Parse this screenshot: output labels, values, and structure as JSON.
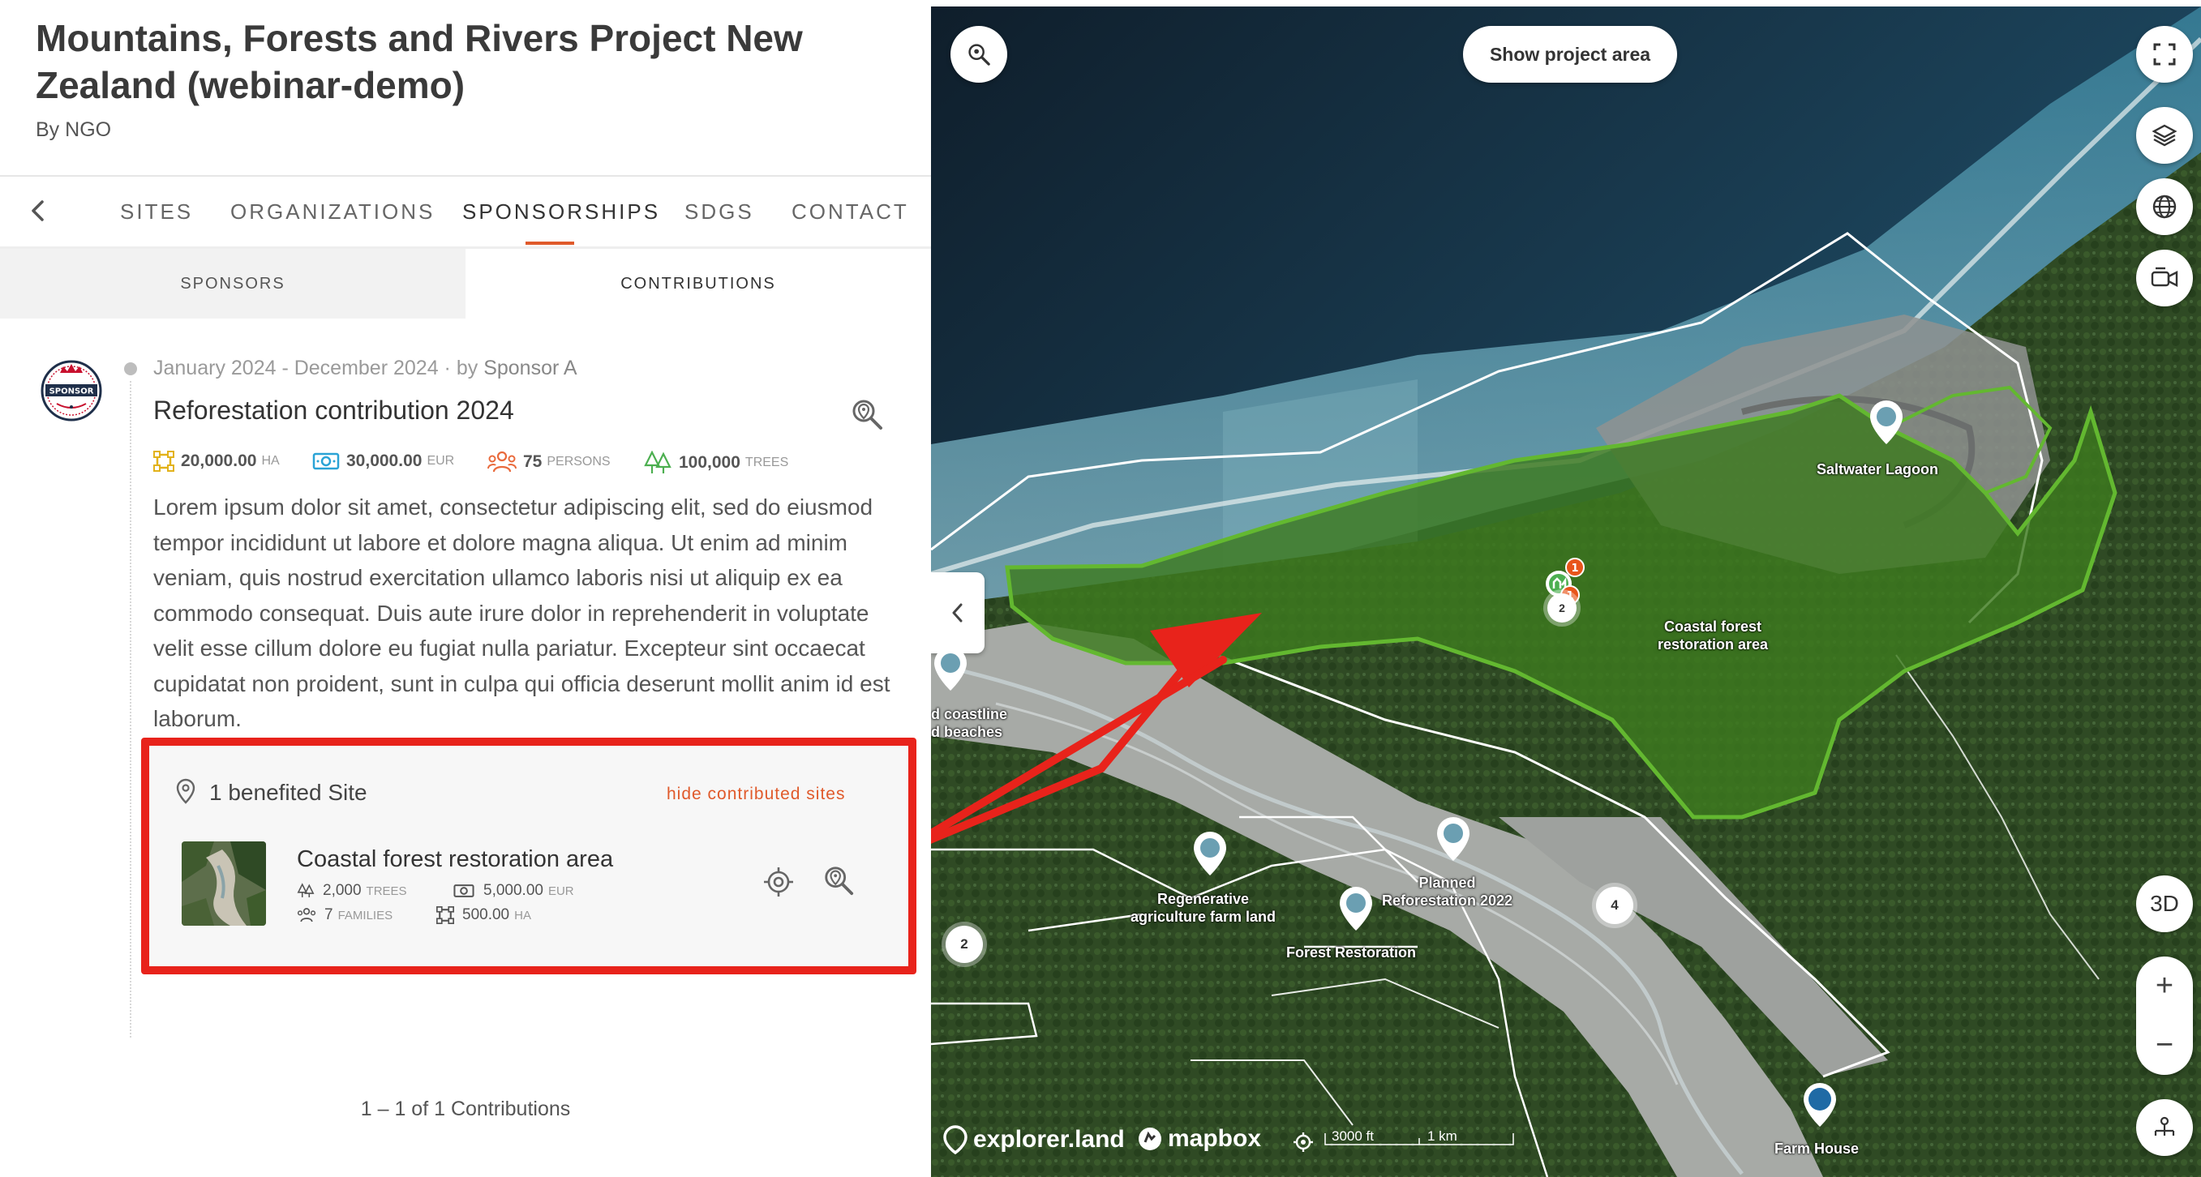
{
  "project": {
    "title": "Mountains, Forests and Rivers Project New Zealand (webinar-demo)",
    "by_prefix": "By",
    "by_org": "NGO"
  },
  "nav": {
    "tabs": [
      "SITES",
      "ORGANIZATIONS",
      "SPONSORSHIPS",
      "SDGS",
      "CONTACT"
    ],
    "active": "SPONSORSHIPS"
  },
  "subtabs": {
    "sponsors": "SPONSORS",
    "contributions": "CONTRIBUTIONS",
    "active": "CONTRIBUTIONS"
  },
  "contribution": {
    "period": "January 2024 - December 2024 · by",
    "sponsor": "Sponsor A",
    "title": "Reforestation contribution 2024",
    "stats": [
      {
        "icon": "area-icon",
        "value": "20,000.00",
        "unit": "HA"
      },
      {
        "icon": "money-icon",
        "value": "30,000.00",
        "unit": "EUR"
      },
      {
        "icon": "people-icon",
        "value": "75",
        "unit": "PERSONS"
      },
      {
        "icon": "trees-icon",
        "value": "100,000",
        "unit": "TREES"
      }
    ],
    "description": "Lorem ipsum dolor sit amet, consectetur adipiscing elit, sed do eiusmod tempor incididunt ut labore et dolore magna aliqua. Ut enim ad minim veniam, quis nostrud exercitation ullamco laboris nisi ut aliquip ex ea commodo consequat. Duis aute irure dolor in reprehenderit in voluptate velit esse cillum dolore eu fugiat nulla pariatur. Excepteur sint occaecat cupidatat non proident, sunt in culpa qui officia deserunt mollit anim id est laborum.",
    "sponsor_logo_text": "SPONSOR"
  },
  "benefited": {
    "title": "1 benefited Site",
    "hide_link": "hide contributed sites",
    "site": {
      "name": "Coastal forest restoration area",
      "trees_value": "2,000",
      "trees_unit": "TREES",
      "money_value": "5,000.00",
      "money_unit": "EUR",
      "families_value": "7",
      "families_unit": "FAMILIES",
      "area_value": "500.00",
      "area_unit": "HA"
    }
  },
  "pagination": "1 – 1 of 1 Contributions",
  "map": {
    "show_area_button": "Show project area",
    "btn_3d": "3D",
    "zoom_in": "+",
    "zoom_out": "−",
    "labels": {
      "saltwater": "Saltwater Lagoon",
      "coastal": "Coastal forest\nrestoration area",
      "coastline": "d coastline\nd beaches",
      "regenerative": "Regenerative\nagriculture farm land",
      "planned": "Planned\nReforestation 2022",
      "forest_restoration": "Forest Restoration",
      "farm_house": "Farm House"
    },
    "clusters": {
      "c1": "2",
      "c2": "4",
      "c3": "2"
    },
    "badges": {
      "b1": "1",
      "b2": "1"
    },
    "attribution": {
      "explorer": "explorer.land",
      "mapbox": "mapbox"
    },
    "scale": {
      "ft": "3000 ft",
      "km": "1 km"
    },
    "colors": {
      "accent": "#e05a2b",
      "highlight_border": "#e8231b",
      "forest_polygon": "#3d7a1e",
      "pin_blue": "#1f6aa5"
    }
  }
}
